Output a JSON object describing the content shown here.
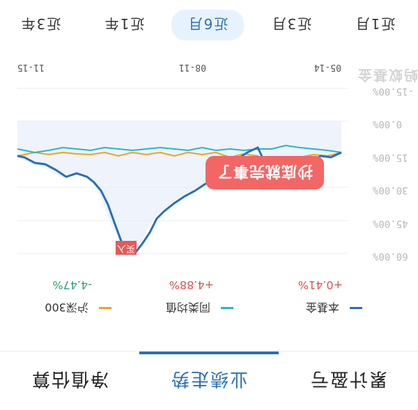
{
  "bottom_tabs": [
    {
      "label": "累计盈亏"
    },
    {
      "label": "业绩走势"
    },
    {
      "label": "净值估算"
    }
  ],
  "legend": [
    {
      "name": "本基金",
      "value": "+0.41%",
      "color": "#2a6fb5",
      "value_color": "#d9544f"
    },
    {
      "name": "同类均值",
      "value": "+4.88%",
      "color": "#25b6c8",
      "value_color": "#d9544f"
    },
    {
      "name": "沪深300",
      "value": "-4.47%",
      "color": "#f0a21e",
      "value_color": "#2aa36b"
    }
  ],
  "chart": {
    "y_ticks": [
      "60.00%",
      "45.00%",
      "30.00%",
      "15.00%",
      "0.00%",
      "-15.00%"
    ],
    "x_ticks": [
      "05-14",
      "08-11",
      "11-15"
    ],
    "annotation": "抄底就完事了",
    "buy_marker": "买入",
    "watermark": "蚂蚁基金"
  },
  "period_tabs": [
    {
      "label": "近1月"
    },
    {
      "label": "近3月"
    },
    {
      "label": "近6月"
    },
    {
      "label": "近1年"
    },
    {
      "label": "近3年"
    }
  ],
  "chart_data": {
    "type": "line",
    "ylabel": "",
    "ylim": [
      -15,
      60
    ],
    "x": [
      "05-14",
      "08-11",
      "11-15"
    ],
    "series": [
      {
        "name": "本基金",
        "values": [
          0,
          -5,
          -12,
          -20,
          -40,
          -45,
          -35,
          -25,
          -15,
          -10,
          -5,
          -3,
          0.41
        ]
      },
      {
        "name": "同类均值",
        "values": [
          0,
          -1,
          -3,
          -5,
          -6,
          -7,
          -5,
          -4,
          -5,
          -4,
          -3,
          -4,
          4.88
        ]
      },
      {
        "name": "沪深300",
        "values": [
          0,
          2,
          1,
          -2,
          3,
          2,
          4,
          1,
          3,
          2,
          4,
          3,
          -4.47
        ]
      }
    ]
  }
}
